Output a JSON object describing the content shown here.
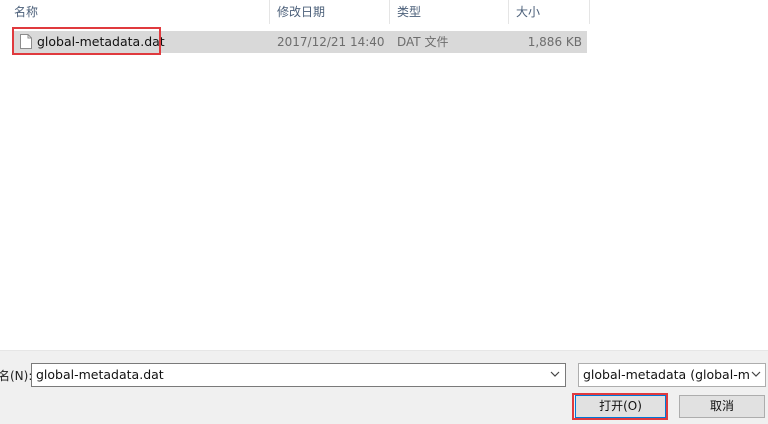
{
  "columns": {
    "name": "名称",
    "date_modified": "修改日期",
    "type": "类型",
    "size": "大小"
  },
  "files": [
    {
      "name": "global-metadata.dat",
      "date_modified": "2017/12/21 14:40",
      "type": "DAT 文件",
      "size": "1,886 KB",
      "icon": "document-icon",
      "selected": true
    }
  ],
  "bottom": {
    "filename_label": "名(N):",
    "filename_value": "global-metadata.dat",
    "filter_value": "global-metadata (global-me",
    "open_label": "打开(O)",
    "cancel_label": "取消"
  },
  "colors": {
    "highlight": "#e03a3e",
    "selected_row": "#d9d9d9",
    "header_text": "#4c607a",
    "panel_bg": "#f0f0f0",
    "focus_border": "#0078d7"
  }
}
